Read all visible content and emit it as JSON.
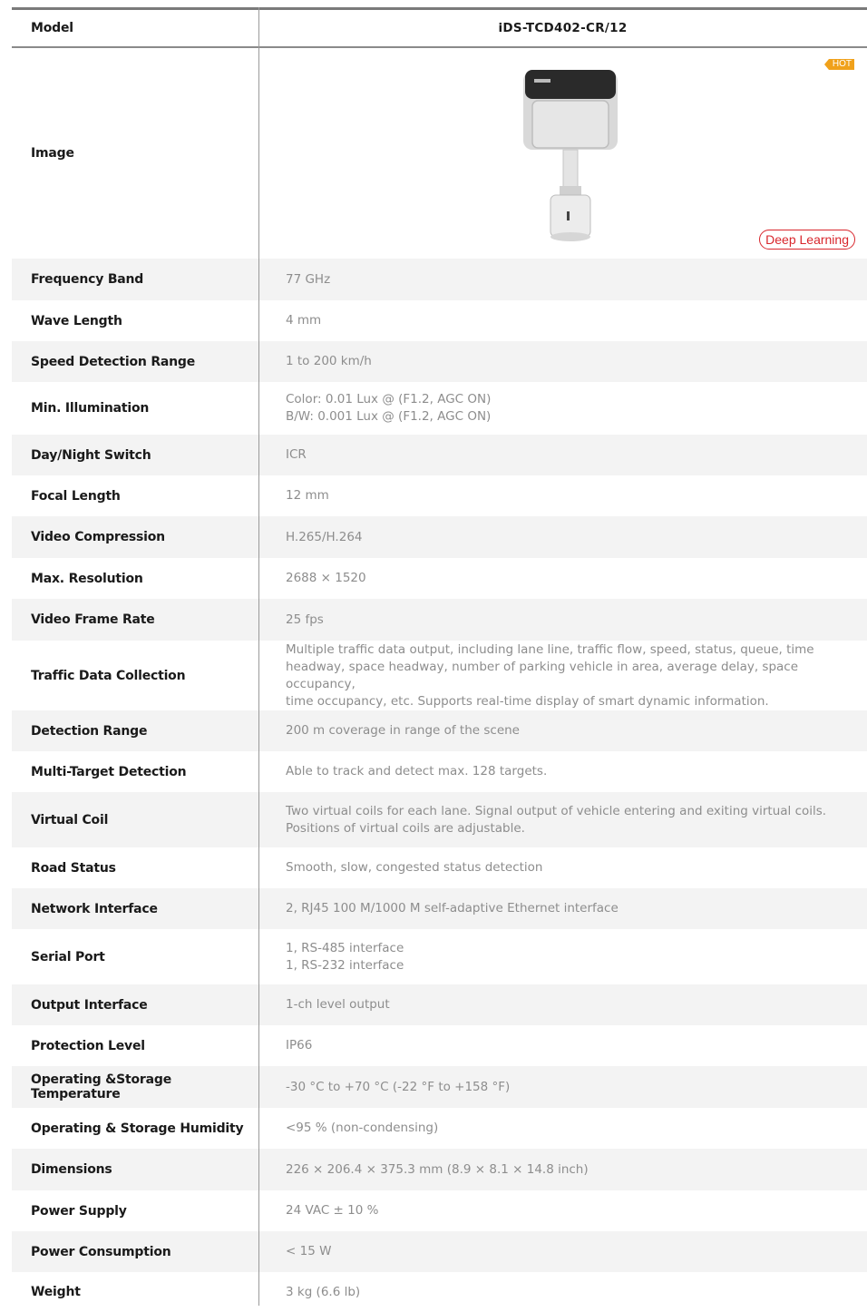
{
  "header": {
    "label": "Model",
    "value": "iDS-TCD402-CR/12"
  },
  "image_row": {
    "label": "Image",
    "hot_badge": "HOT",
    "deep_learning_badge": "Deep Learning"
  },
  "specs": [
    {
      "label": "Frequency Band",
      "lines": [
        "77 GHz"
      ]
    },
    {
      "label": "Wave Length",
      "lines": [
        "4 mm"
      ]
    },
    {
      "label": "Speed Detection Range",
      "lines": [
        "1 to 200 km/h"
      ]
    },
    {
      "label": "Min. Illumination",
      "lines": [
        "Color: 0.01 Lux @ (F1.2, AGC ON)",
        "B/W: 0.001 Lux @ (F1.2, AGC ON)"
      ]
    },
    {
      "label": "Day/Night Switch",
      "lines": [
        "ICR"
      ]
    },
    {
      "label": "Focal Length",
      "lines": [
        "12 mm"
      ]
    },
    {
      "label": "Video Compression",
      "lines": [
        "H.265/H.264"
      ]
    },
    {
      "label": "Max. Resolution",
      "lines": [
        "2688 × 1520"
      ]
    },
    {
      "label": "Video Frame Rate",
      "lines": [
        "25 fps"
      ]
    },
    {
      "label": "Traffic Data Collection",
      "lines": [
        "Multiple traffic data output, including lane line, traffic flow, speed, status, queue, time",
        "headway, space headway, number of parking vehicle in area, average delay, space occupancy,",
        "time occupancy, etc. Supports real-time display of smart dynamic information."
      ]
    },
    {
      "label": "Detection Range",
      "lines": [
        "200 m coverage in range of the scene"
      ]
    },
    {
      "label": "Multi-Target Detection",
      "lines": [
        "Able to track and detect max. 128 targets."
      ]
    },
    {
      "label": "Virtual Coil",
      "lines": [
        "Two virtual coils for each lane. Signal output of vehicle entering and exiting virtual coils.",
        "Positions of virtual coils are adjustable."
      ]
    },
    {
      "label": "Road Status",
      "lines": [
        "Smooth, slow, congested status detection"
      ]
    },
    {
      "label": "Network Interface",
      "lines": [
        "2, RJ45 100 M/1000 M self-adaptive Ethernet interface"
      ]
    },
    {
      "label": "Serial Port",
      "lines": [
        "1, RS-485 interface",
        "1, RS-232 interface"
      ]
    },
    {
      "label": "Output Interface",
      "lines": [
        "1-ch level output"
      ]
    },
    {
      "label": "Protection Level",
      "lines": [
        "IP66"
      ]
    },
    {
      "label": "Operating &Storage Temperature",
      "lines": [
        "-30 °C to +70 °C (-22 °F to +158 °F)"
      ]
    },
    {
      "label": "Operating & Storage Humidity",
      "lines": [
        "<95 % (non-condensing)"
      ]
    },
    {
      "label": "Dimensions",
      "lines": [
        "226 × 206.4 × 375.3 mm (8.9 × 8.1 × 14.8 inch)"
      ]
    },
    {
      "label": "Power Supply",
      "lines": [
        "24 VAC ± 10 %"
      ]
    },
    {
      "label": "Power Consumption",
      "lines": [
        "< 15 W"
      ]
    },
    {
      "label": "Weight",
      "lines": [
        "3 kg (6.6 lb)"
      ]
    }
  ]
}
